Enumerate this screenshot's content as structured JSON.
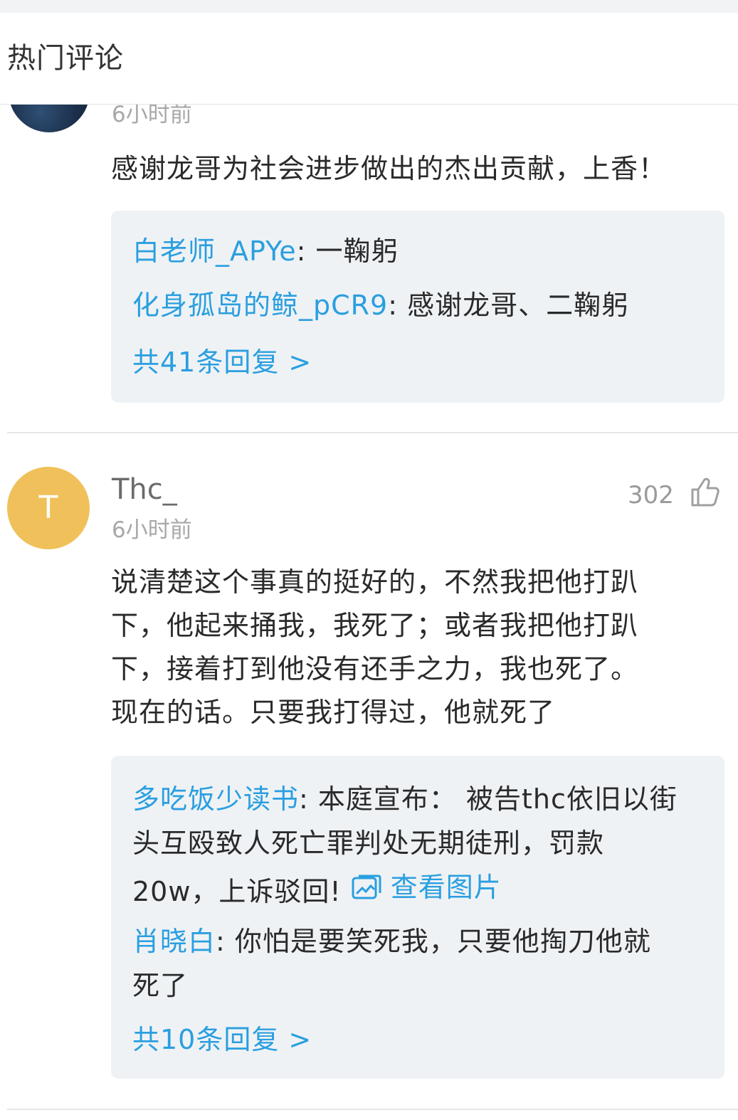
{
  "section": {
    "title": "热门评论"
  },
  "comment1": {
    "time": "6小时前",
    "text": "感谢龙哥为社会进步做出的杰出贡献，上香！",
    "replies": [
      {
        "author": "白老师_APYe",
        "sep": ": ",
        "text": "一鞠躬"
      },
      {
        "author": "化身孤岛的鲸_pCR9",
        "sep": ": ",
        "text": "感谢龙哥、二鞠躬"
      }
    ],
    "reply_count": "共41条回复 >"
  },
  "comment2": {
    "avatar_letter": "T",
    "avatar_color": "#f0c15a",
    "username": "Thc_",
    "time": "6小时前",
    "likes": "302",
    "like_icon": "thumbs-up-icon",
    "text_lines": [
      "说清楚这个事真的挺好的，不然我把他打趴",
      "下，他起来捅我，我死了；或者我把他打趴",
      "下，接着打到他没有还手之力，我也死了。",
      "现在的话。只要我打得过，他就死了"
    ],
    "replies": [
      {
        "author": "多吃饭少读书",
        "sep": ": ",
        "lines": [
          "本庭宣布：  被告thc依旧以街",
          "头互殴致人死亡罪判处无期徒刑，罚款",
          "20w，上诉驳回! "
        ],
        "view_image": "查看图片",
        "view_image_icon": "image-icon"
      },
      {
        "author": "肖晓白",
        "sep": ": ",
        "lines": [
          "你怕是要笑死我，只要他掏刀他就",
          "死了"
        ]
      }
    ],
    "reply_count": "共10条回复 >"
  },
  "colors": {
    "link": "#2a9fe0",
    "reply_bg": "#eff2f5",
    "muted": "#a8a8a8"
  }
}
